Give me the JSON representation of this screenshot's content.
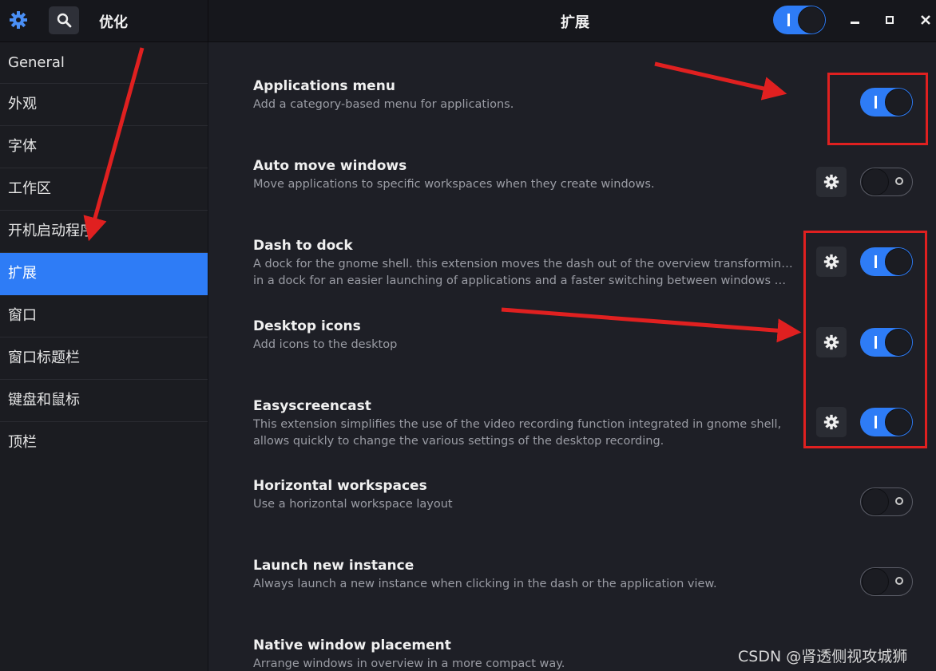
{
  "header": {
    "app_title": "优化",
    "page_title": "扩展",
    "extensions_enabled": true,
    "minimize_label": "‒",
    "maximize_label": "▫",
    "close_label": "✕"
  },
  "sidebar": {
    "items": [
      {
        "label": "General",
        "active": false
      },
      {
        "label": "外观",
        "active": false
      },
      {
        "label": "字体",
        "active": false
      },
      {
        "label": "工作区",
        "active": false
      },
      {
        "label": "开机启动程序",
        "active": false
      },
      {
        "label": "扩展",
        "active": true
      },
      {
        "label": "窗口",
        "active": false
      },
      {
        "label": "窗口标题栏",
        "active": false
      },
      {
        "label": "键盘和鼠标",
        "active": false
      },
      {
        "label": "顶栏",
        "active": false
      }
    ]
  },
  "extensions": [
    {
      "title": "Applications menu",
      "desc": "Add a category-based menu for applications.",
      "enabled": true,
      "has_settings": false
    },
    {
      "title": "Auto move windows",
      "desc": "Move applications to specific workspaces when they create windows.",
      "enabled": false,
      "has_settings": true
    },
    {
      "title": "Dash to dock",
      "desc_lines": [
        "A dock for the gnome shell. this extension moves the dash out of the overview transforming it",
        "in a dock for an easier launching of applications and a faster switching between windows and..."
      ],
      "enabled": true,
      "has_settings": true
    },
    {
      "title": "Desktop icons",
      "desc": "Add icons to the desktop",
      "enabled": true,
      "has_settings": true
    },
    {
      "title": "Easyscreencast",
      "desc_lines": [
        "This extension simplifies the use of the video recording function integrated in gnome shell,",
        "allows quickly to change the various settings of the desktop recording."
      ],
      "enabled": true,
      "has_settings": true
    },
    {
      "title": "Horizontal workspaces",
      "desc": "Use a horizontal workspace layout",
      "enabled": false,
      "has_settings": false
    },
    {
      "title": "Launch new instance",
      "desc": "Always launch a new instance when clicking in the dash or the application view.",
      "enabled": false,
      "has_settings": false
    },
    {
      "title": "Native window placement",
      "desc": "Arrange windows in overview in a more compact way.",
      "enabled": false,
      "has_settings": false
    }
  ],
  "watermark": "CSDN @肾透侧视攻城狮",
  "colors": {
    "accent": "#2e7cf6",
    "annotation": "#e02020",
    "background": "#1e1f26",
    "header": "#16171c"
  }
}
